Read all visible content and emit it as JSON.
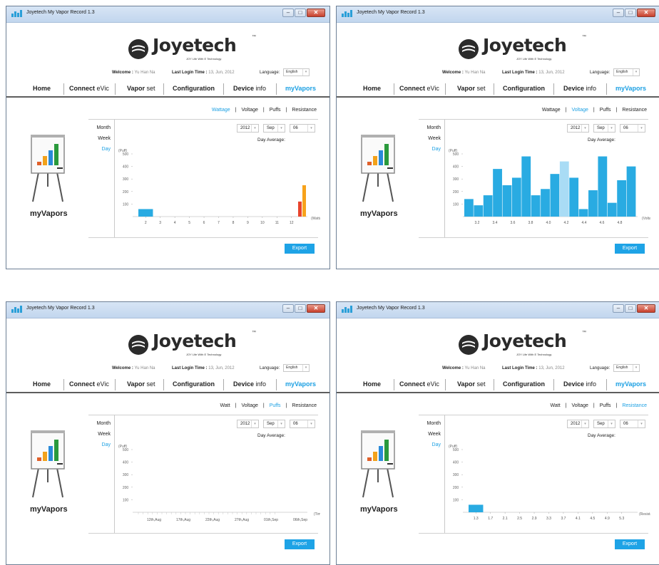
{
  "app": {
    "window_title": "Joyetech My Vapor Record 1.3",
    "brand": "Joyetech",
    "brand_tagline": "JOY Life With E Technology"
  },
  "header": {
    "welcome_label": "Welcome :",
    "welcome_name": "Yu Han Na",
    "last_login_label": "Last Login Time :",
    "last_login_value": "13, Jun, 2012",
    "language_label": "Language:",
    "language_value": "English"
  },
  "nav": [
    {
      "bold": "Home",
      "rest": ""
    },
    {
      "bold": "Connect",
      "rest": " eVic"
    },
    {
      "bold": "Vapor",
      "rest": " set"
    },
    {
      "bold": "Configuration",
      "rest": ""
    },
    {
      "bold": "Device",
      "rest": " info"
    },
    {
      "bold": "myVapors",
      "rest": "",
      "active": true
    }
  ],
  "sidebar": {
    "title": "myVapors",
    "periods": [
      "Month",
      "Week",
      "Day"
    ],
    "active_period": "Day"
  },
  "filters": {
    "year": "2012",
    "month": "Sep",
    "day": "06"
  },
  "day_average_label": "Day Average:",
  "export_label": "Export",
  "colors": {
    "accent": "#1ca0e3",
    "bar": "#29abe2",
    "bar_highlight": "#a9dcf5",
    "wattage_low": "#e8442c",
    "wattage_high": "#f7a21b"
  },
  "panels": [
    {
      "tabs": [
        "Wattage",
        "Voltage",
        "Puffs",
        "Resistance"
      ],
      "active_tab": "Wattage",
      "chart_data": {
        "type": "bar",
        "ylabel": "(Puff)",
        "xlabel": "(Wattage)",
        "ylim": [
          0,
          500
        ],
        "yticks": [
          100,
          200,
          300,
          400,
          500
        ],
        "categories": [
          "2",
          "3",
          "4",
          "5",
          "6",
          "7",
          "8",
          "9",
          "10",
          "11",
          "12"
        ],
        "values": [
          60,
          0,
          0,
          0,
          0,
          0,
          0,
          0,
          0,
          0,
          0
        ],
        "gradient_bars": [
          {
            "after": "12",
            "values": [
              120,
              250
            ]
          }
        ]
      }
    },
    {
      "tabs": [
        "Wattage",
        "Voltage",
        "Puffs",
        "Resistance"
      ],
      "active_tab": "Voltage",
      "chart_data": {
        "type": "bar",
        "ylabel": "(Puff)",
        "xlabel": "(Voltage)",
        "ylim": [
          0,
          500
        ],
        "yticks": [
          100,
          200,
          300,
          400,
          500
        ],
        "xticks": [
          "3.2",
          "3.4",
          "3.6",
          "3.8",
          "4.0",
          "4.2",
          "4.4",
          "4.6",
          "4.8"
        ],
        "values": [
          140,
          90,
          170,
          380,
          250,
          310,
          480,
          170,
          220,
          340,
          440,
          310,
          60,
          210,
          480,
          110,
          290,
          400
        ],
        "highlight_index": 10
      }
    },
    {
      "tabs": [
        "Watt",
        "Voltage",
        "Puffs",
        "Resistance"
      ],
      "active_tab": "Puffs",
      "chart_data": {
        "type": "bar",
        "ylabel": "(Puff)",
        "xlabel": "(Time)",
        "ylim": [
          0,
          500
        ],
        "yticks": [
          100,
          200,
          300,
          400,
          500
        ],
        "xticks": [
          "12th,Aug",
          "17th,Aug",
          "22th,Aug",
          "27th,Aug",
          "01th,Sep",
          "06th,Sep"
        ],
        "values": []
      }
    },
    {
      "tabs": [
        "Watt",
        "Voltage",
        "Puffs",
        "Resistance"
      ],
      "active_tab": "Resistance",
      "chart_data": {
        "type": "bar",
        "ylabel": "(Puff)",
        "xlabel": "(Resistance)",
        "ylim": [
          0,
          500
        ],
        "yticks": [
          100,
          200,
          300,
          400,
          500
        ],
        "categories": [
          "1.3",
          "1.7",
          "2.1",
          "2.5",
          "2.9",
          "3.3",
          "3.7",
          "4.1",
          "4.5",
          "4.9",
          "5.3"
        ],
        "values": [
          60,
          0,
          0,
          0,
          0,
          0,
          0,
          0,
          0,
          0,
          0
        ]
      }
    }
  ]
}
